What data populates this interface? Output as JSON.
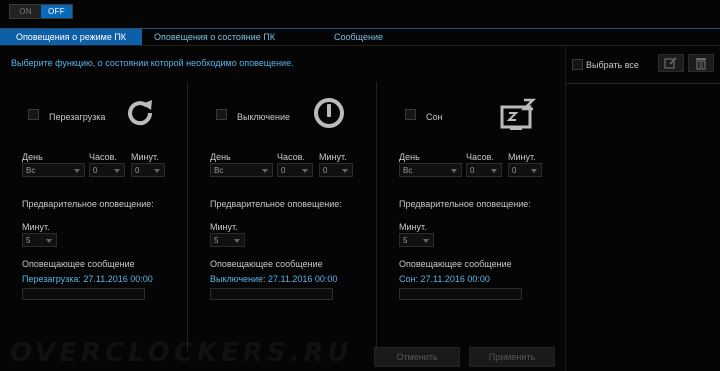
{
  "toggle": {
    "on_label": "ON",
    "off_label": "OFF",
    "active": "OFF"
  },
  "tabs": [
    {
      "label": "Оповещения о режиме ПК",
      "active": true
    },
    {
      "label": "Оповещения о состояние ПК",
      "active": false
    },
    {
      "label": "Сообщение",
      "active": false
    }
  ],
  "hint": "Выберите функцию, о состоянии которой необходимо оповещение.",
  "columns": [
    {
      "name": "Перезагрузка",
      "icon": "restart-icon",
      "day_label": "День",
      "hours_label": "Часов.",
      "minutes_label": "Минут.",
      "day_value": "Вс",
      "hours_value": "0",
      "minutes_value": "0",
      "pre_alert_label": "Предварительное оповещение:",
      "pre_minutes_label": "Минут.",
      "pre_minutes_value": "5",
      "message_label": "Оповещающее сообщение",
      "message_text": "Перезагрузка: 27.11.2016 00:00"
    },
    {
      "name": "Выключение",
      "icon": "power-icon",
      "day_label": "День",
      "hours_label": "Часов.",
      "minutes_label": "Минут.",
      "day_value": "Вс",
      "hours_value": "0",
      "minutes_value": "0",
      "pre_alert_label": "Предварительное оповещение:",
      "pre_minutes_label": "Минут.",
      "pre_minutes_value": "5",
      "message_label": "Оповещающее сообщение",
      "message_text": "Выключение: 27.11.2016 00:00"
    },
    {
      "name": "Сон",
      "icon": "sleep-icon",
      "day_label": "День",
      "hours_label": "Часов.",
      "minutes_label": "Минут.",
      "day_value": "Вс",
      "hours_value": "0",
      "minutes_value": "0",
      "pre_alert_label": "Предварительное оповещение:",
      "pre_minutes_label": "Минут.",
      "pre_minutes_value": "5",
      "message_label": "Оповещающее сообщение",
      "message_text": "Сон: 27.11.2016 00:00"
    }
  ],
  "right_panel": {
    "select_all_label": "Выбрать все",
    "edit_icon": "edit-icon",
    "delete_icon": "trash-icon"
  },
  "footer": {
    "cancel_label": "Отменить",
    "apply_label": "Применить"
  },
  "watermark": "OVERCLOCKERS.RU",
  "colors": {
    "accent": "#0d5fa8",
    "link_text": "#5ab3e8",
    "background": "#050505"
  }
}
